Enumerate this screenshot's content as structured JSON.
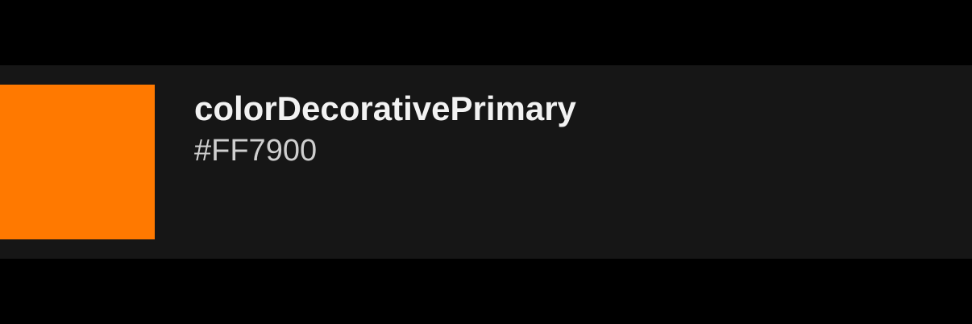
{
  "token": {
    "name": "colorDecorativePrimary",
    "value": "#FF7900",
    "swatch_color": "#FF7900"
  },
  "colors": {
    "background": "#000000",
    "card_background": "#161616",
    "name_text": "#F2F2F2",
    "value_text": "#CFCFCF"
  }
}
